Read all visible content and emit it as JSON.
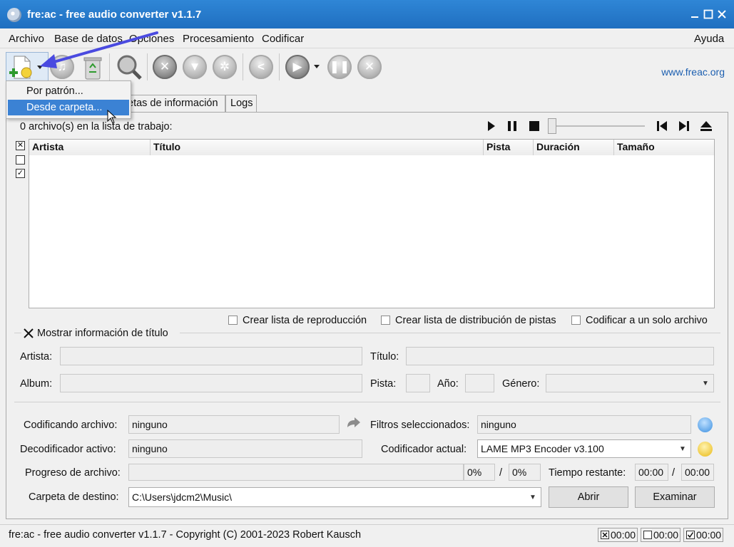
{
  "window": {
    "title": "fre:ac - free audio converter v1.1.7",
    "minimize_icon": "minimize-icon",
    "maximize_icon": "maximize-icon",
    "close_icon": "close-icon"
  },
  "menu": {
    "items": [
      "Archivo",
      "Base de datos",
      "Opciones",
      "Procesamiento",
      "Codificar"
    ],
    "help": "Ayuda"
  },
  "toolbar": {
    "link": "www.freac.org",
    "icons": [
      "add-files-icon",
      "dropdown-arrow-icon",
      "cd-icon",
      "recycle-bin-icon",
      "search-cddb-icon",
      "settings-tools-icon",
      "filter-icon",
      "gear-icon",
      "share-icon",
      "play-icon",
      "pause-icon",
      "stop-icon"
    ]
  },
  "popup_menu": {
    "items": [
      "Por patrón...",
      "Desde carpeta..."
    ],
    "selected_index": 1
  },
  "tabs": {
    "partial_label": "etas de información",
    "logs": "Logs"
  },
  "joblist": {
    "count_text": "0 archivo(s) en la lista de trabajo:",
    "columns": [
      "Artista",
      "Título",
      "Pista",
      "Duración",
      "Tamaño"
    ],
    "player_icons": [
      "play-icon",
      "pause-icon",
      "stop-icon",
      "previous-track-icon",
      "next-track-icon",
      "eject-icon"
    ]
  },
  "options": {
    "playlist": "Crear lista de reproducción",
    "cuesheet": "Crear lista de distribución de pistas",
    "single_file": "Codificar a un solo archivo"
  },
  "title_info": {
    "toggle_label": "Mostrar información de título",
    "toggle_checked": true,
    "artist_label": "Artista:",
    "title_label": "Título:",
    "album_label": "Album:",
    "track_label": "Pista:",
    "year_label": "Año:",
    "genre_label": "Género:"
  },
  "encoding": {
    "encoding_file_label": "Codificando archivo:",
    "encoding_file_value": "ninguno",
    "filters_label": "Filtros seleccionados:",
    "filters_value": "ninguno",
    "decoder_label": "Decodificador activo:",
    "decoder_value": "ninguno",
    "encoder_label": "Codificador actual:",
    "encoder_value": "LAME MP3 Encoder v3.100",
    "progress_label": "Progreso de archivo:",
    "progress_file": "0%",
    "progress_sep": "/",
    "progress_total": "0%",
    "remaining_label": "Tiempo restante:",
    "remaining_file": "00:00",
    "remaining_sep": "/",
    "remaining_total": "00:00",
    "dest_label": "Carpeta de destino:",
    "dest_value": "C:\\Users\\jdcm2\\Music\\",
    "open_button": "Abrir",
    "browse_button": "Examinar"
  },
  "status": {
    "text": "fre:ac - free audio converter v1.1.7 - Copyright (C) 2001-2023 Robert Kausch",
    "time1": "00:00",
    "time2": "00:00",
    "time3": "00:00"
  }
}
